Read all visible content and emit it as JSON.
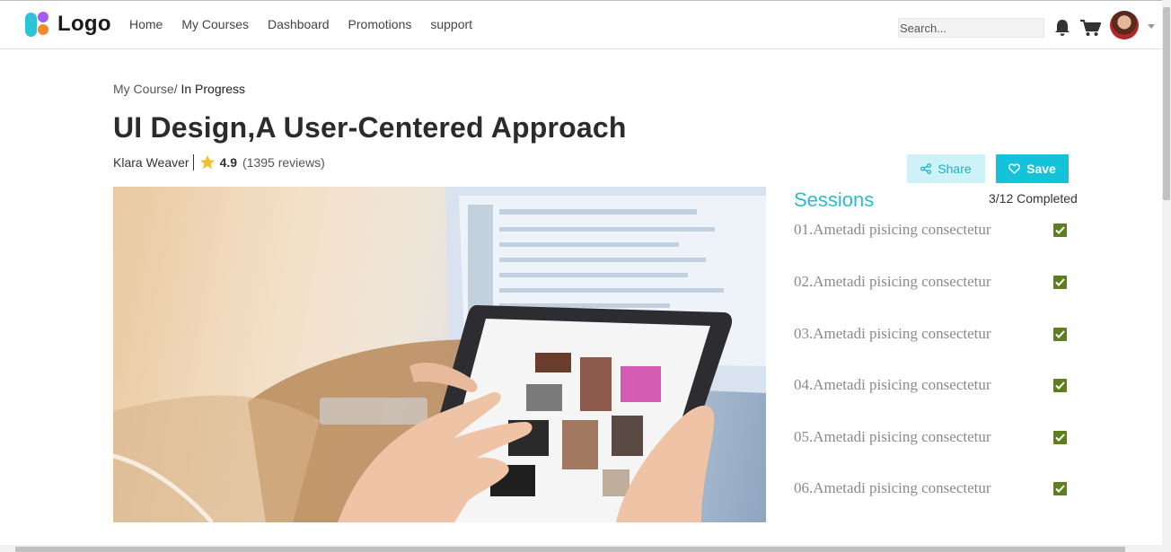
{
  "nav": {
    "logo_text": "Logo",
    "links": [
      "Home",
      "My Courses",
      "Dashboard",
      "Promotions",
      "support"
    ],
    "search_placeholder": "Search..."
  },
  "breadcrumb": {
    "parent": "My Course",
    "separator": "/",
    "current": " In Progress"
  },
  "course": {
    "title": "UI Design,A User-Centered Approach",
    "author": "Klara Weaver",
    "rating": "4.9",
    "reviews": "(1395 reviews)"
  },
  "actions": {
    "share_label": "Share",
    "save_label": "Save"
  },
  "sessions": {
    "title": "Sessions",
    "completed": "3/12 Completed",
    "items": [
      {
        "label": "01.Ametadi pisicing consectetur",
        "checked": true
      },
      {
        "label": "02.Ametadi pisicing consectetur",
        "checked": true
      },
      {
        "label": "03.Ametadi pisicing consectetur",
        "checked": true
      },
      {
        "label": "04.Ametadi pisicing consectetur",
        "checked": true
      },
      {
        "label": "05.Ametadi pisicing consectetur",
        "checked": true
      },
      {
        "label": "06.Ametadi pisicing consectetur",
        "checked": true
      }
    ]
  },
  "colors": {
    "accent": "#14c3d9",
    "accent_light": "#cdf3f8",
    "check": "#5d7f1e",
    "star": "#f2c12e"
  },
  "icons": [
    "bell-icon",
    "cart-icon",
    "share-icon",
    "heart-icon",
    "star-icon",
    "check-icon"
  ]
}
